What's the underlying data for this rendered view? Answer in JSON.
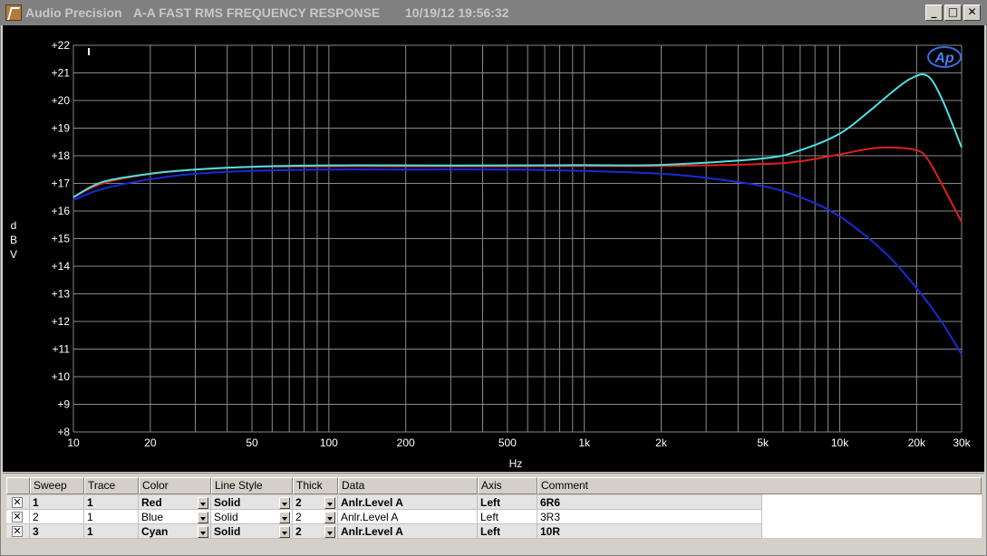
{
  "titlebar": {
    "app": "Audio Precision",
    "test_name": "A-A FAST RMS FREQUENCY RESPONSE",
    "datetime": "10/19/12 19:56:32",
    "min_glyph": "_",
    "max_glyph": "□",
    "close_glyph": "✕"
  },
  "plot": {
    "logo_text": "Ap",
    "y_unit_letters": [
      "d",
      "B",
      "V"
    ],
    "x_unit": "Hz",
    "colors": {
      "background": "#000000",
      "grid": "#8a8a8a",
      "axis_text": "#ffffff",
      "red": "#e0201c",
      "blue": "#1a2ad8",
      "cyan": "#4fe0e0"
    }
  },
  "chart_data": {
    "type": "line",
    "title": "",
    "xlabel": "Hz",
    "ylabel": "dBV",
    "x_scale": "log",
    "xlim": [
      10,
      30000
    ],
    "ylim": [
      8,
      22
    ],
    "x_ticks": [
      {
        "v": 10,
        "label": "10"
      },
      {
        "v": 20,
        "label": "20"
      },
      {
        "v": 50,
        "label": "50"
      },
      {
        "v": 100,
        "label": "100"
      },
      {
        "v": 200,
        "label": "200"
      },
      {
        "v": 500,
        "label": "500"
      },
      {
        "v": 1000,
        "label": "1k"
      },
      {
        "v": 2000,
        "label": "2k"
      },
      {
        "v": 5000,
        "label": "5k"
      },
      {
        "v": 10000,
        "label": "10k"
      },
      {
        "v": 20000,
        "label": "20k"
      },
      {
        "v": 30000,
        "label": "30k"
      }
    ],
    "y_ticks": [
      {
        "v": 22,
        "label": "+22"
      },
      {
        "v": 21,
        "label": "+21"
      },
      {
        "v": 20,
        "label": "+20"
      },
      {
        "v": 19,
        "label": "+19"
      },
      {
        "v": 18,
        "label": "+18"
      },
      {
        "v": 17,
        "label": "+17"
      },
      {
        "v": 16,
        "label": "+16"
      },
      {
        "v": 15,
        "label": "+15"
      },
      {
        "v": 14,
        "label": "+14"
      },
      {
        "v": 13,
        "label": "+13"
      },
      {
        "v": 12,
        "label": "+12"
      },
      {
        "v": 11,
        "label": "+11"
      },
      {
        "v": 10,
        "label": "+10"
      },
      {
        "v": 9,
        "label": "+9"
      },
      {
        "v": 8,
        "label": "+8"
      }
    ],
    "grid": true,
    "series": [
      {
        "color": "#e0201c",
        "x": [
          10,
          13,
          20,
          30,
          50,
          100,
          200,
          500,
          1000,
          2000,
          5000,
          7000,
          10000,
          13000,
          16000,
          20000,
          22000,
          25000,
          30000
        ],
        "y": [
          16.5,
          17.0,
          17.35,
          17.5,
          17.6,
          17.62,
          17.62,
          17.62,
          17.63,
          17.63,
          17.7,
          17.8,
          18.05,
          18.25,
          18.3,
          18.2,
          17.9,
          17.0,
          15.6
        ]
      },
      {
        "color": "#1a2ad8",
        "x": [
          10,
          13,
          20,
          30,
          50,
          100,
          200,
          500,
          1000,
          2000,
          3000,
          5000,
          7000,
          10000,
          15000,
          20000,
          25000,
          30000
        ],
        "y": [
          16.4,
          16.8,
          17.15,
          17.35,
          17.45,
          17.5,
          17.5,
          17.5,
          17.45,
          17.35,
          17.2,
          16.9,
          16.5,
          15.8,
          14.5,
          13.2,
          12.0,
          10.8
        ]
      },
      {
        "color": "#4fe0e0",
        "x": [
          10,
          13,
          20,
          30,
          50,
          100,
          200,
          500,
          1000,
          2000,
          5000,
          7000,
          10000,
          13000,
          16000,
          19000,
          22000,
          25000,
          30000
        ],
        "y": [
          16.5,
          17.05,
          17.35,
          17.5,
          17.6,
          17.65,
          17.65,
          17.65,
          17.66,
          17.67,
          17.9,
          18.2,
          18.8,
          19.6,
          20.3,
          20.8,
          20.9,
          20.1,
          18.3
        ]
      }
    ]
  },
  "table": {
    "headers": [
      "Sweep",
      "Trace",
      "Color",
      "Line Style",
      "Thick",
      "Data",
      "Axis",
      "Comment"
    ],
    "rows": [
      {
        "checked": "✕",
        "sweep": "1",
        "trace": "1",
        "color": "Red",
        "style": "Solid",
        "thick": "2",
        "data": "Anlr.Level A",
        "axis": "Left",
        "comment": "6R6"
      },
      {
        "checked": "✕",
        "sweep": "2",
        "trace": "1",
        "color": "Blue",
        "style": "Solid",
        "thick": "2",
        "data": "Anlr.Level A",
        "axis": "Left",
        "comment": "3R3"
      },
      {
        "checked": "✕",
        "sweep": "3",
        "trace": "1",
        "color": "Cyan",
        "style": "Solid",
        "thick": "2",
        "data": "Anlr.Level A",
        "axis": "Left",
        "comment": "10R"
      }
    ]
  }
}
